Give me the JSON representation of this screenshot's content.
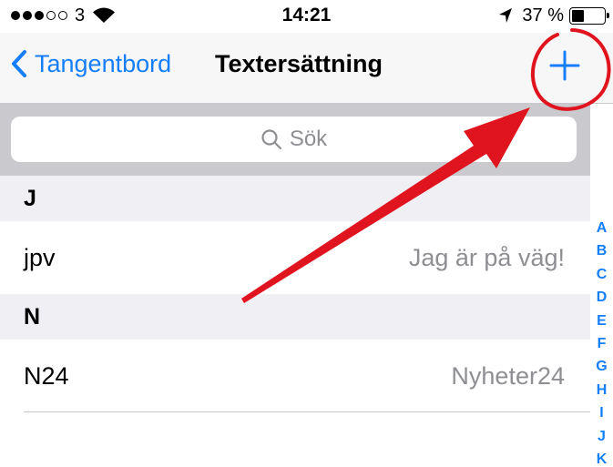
{
  "status_bar": {
    "carrier": "3",
    "time": "14:21",
    "battery_percent": "37 %",
    "battery_level": 0.37
  },
  "nav": {
    "back_label": "Tangentbord",
    "title": "Textersättning",
    "add_icon": "plus-icon"
  },
  "search": {
    "placeholder": "Sök"
  },
  "sections": [
    {
      "header": "J",
      "rows": [
        {
          "shortcut": "jpv",
          "phrase": "Jag är på väg!"
        }
      ]
    },
    {
      "header": "N",
      "rows": [
        {
          "shortcut": "N24",
          "phrase": "Nyheter24"
        }
      ]
    }
  ],
  "index_letters": [
    "A",
    "B",
    "C",
    "D",
    "E",
    "F",
    "G",
    "H",
    "I",
    "J",
    "K"
  ],
  "colors": {
    "accent": "#147efb",
    "annotation": "#e0141e"
  }
}
